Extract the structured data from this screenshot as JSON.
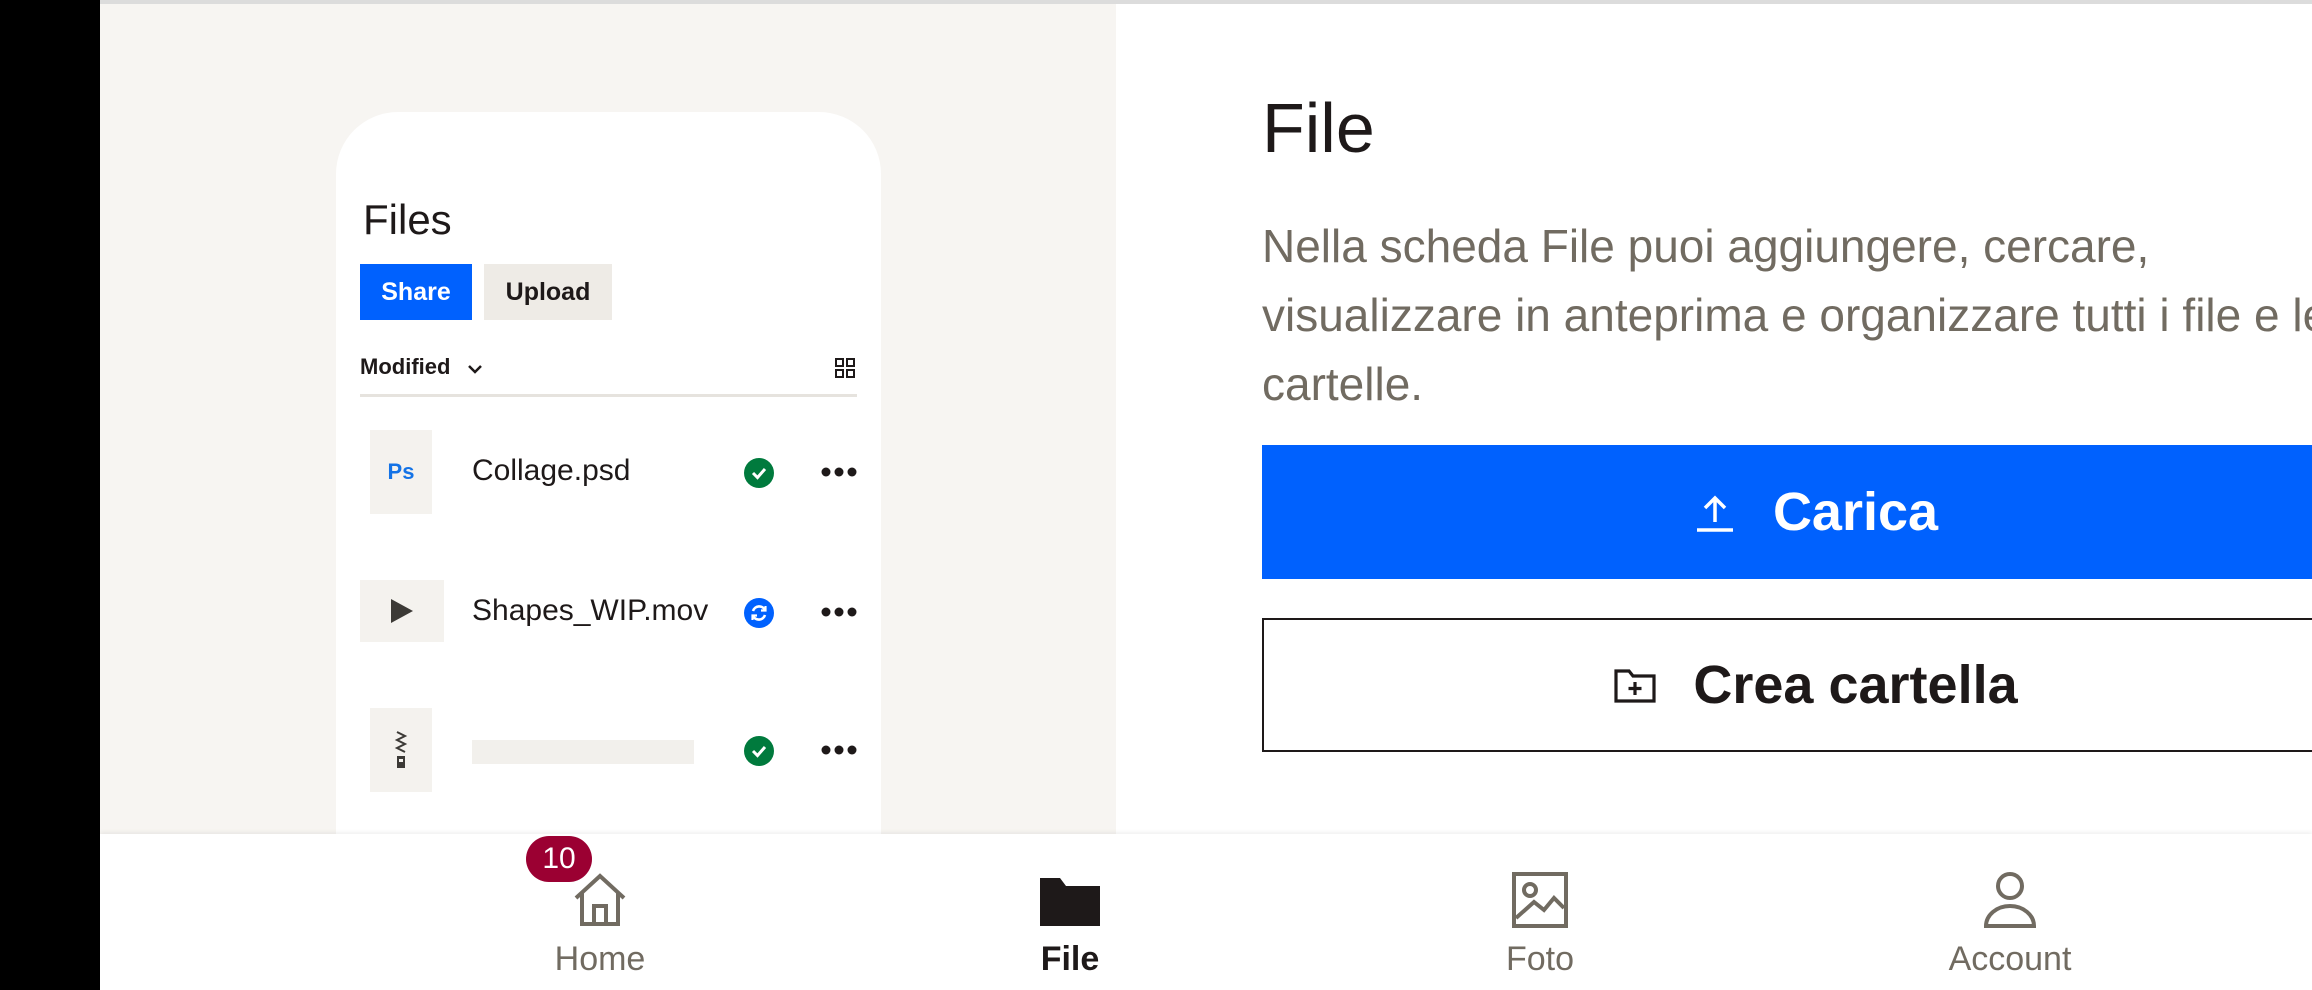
{
  "illustration": {
    "title": "Files",
    "share_label": "Share",
    "upload_label": "Upload",
    "sort_label": "Modified",
    "files": [
      {
        "thumb_text": "Ps",
        "name": "Collage.psd",
        "status": "synced"
      },
      {
        "thumb_text": "",
        "name": "Shapes_WIP.mov",
        "status": "syncing"
      },
      {
        "thumb_text": "",
        "name": "",
        "status": "synced"
      }
    ]
  },
  "content": {
    "title": "File",
    "description": "Nella scheda File puoi aggiungere, cercare, visualizzare in anteprima e organizzare tutti i file e le cartelle.",
    "upload_label": "Carica",
    "create_folder_label": "Crea cartella"
  },
  "nav": {
    "items": [
      {
        "label": "Home",
        "icon": "home-icon"
      },
      {
        "label": "File",
        "icon": "folder-icon"
      },
      {
        "label": "Foto",
        "icon": "photo-icon"
      },
      {
        "label": "Account",
        "icon": "account-icon"
      }
    ],
    "home_badge": "10",
    "active": "File"
  },
  "colors": {
    "accent": "#0061fe",
    "text": "#1e1919",
    "muted": "#716b61",
    "badge": "#9b0032",
    "success": "#007a3d"
  }
}
